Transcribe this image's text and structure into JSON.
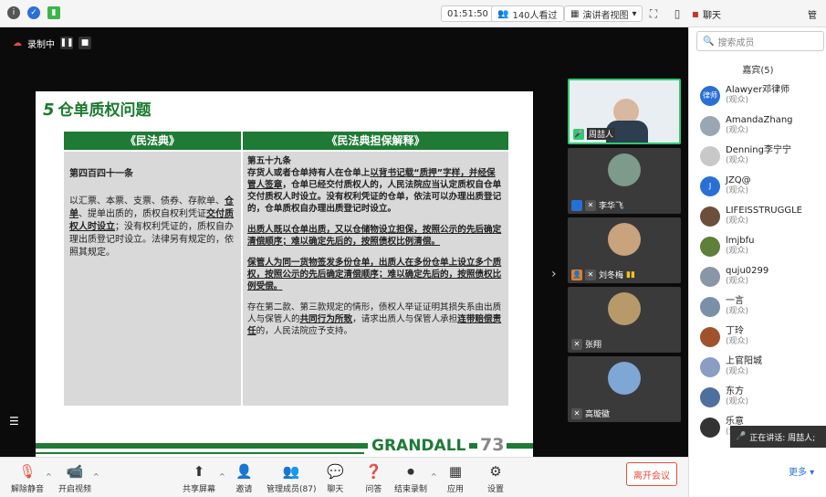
{
  "topbar": {
    "timer": "01:51:50",
    "viewers": "140人看过",
    "view_mode": "演讲者视图",
    "chat_tab": "聊天",
    "tab_right": "管"
  },
  "recording": {
    "label": "录制中"
  },
  "slide": {
    "number": "5",
    "title": "仓单质权问题",
    "col1_head": "《民法典》",
    "col2_head": "《民法典担保解释》",
    "col1_article": "第四百四十一条",
    "col1_text_a": "以汇票、本票、支票、债券、存款单、",
    "col1_text_b": "仓单",
    "col1_text_c": "、提单出质的，质权自权利凭证",
    "col1_text_d": "交付质权人时设立",
    "col1_text_e": "；没有权利凭证的，质权自办理出质登记时设立。法律另有规定的，依照其规定。",
    "col2_article": "第五十九条",
    "col2_p1_a": " 存货人或者仓单持有人在仓单上",
    "col2_p1_b": "以背书记载“质押”字样，并经保管人签章",
    "col2_p1_c": "，仓单已经交付质权人的，人民法院应当认定质权自仓单交付质权人时设立。没有权利凭证的仓单，依法可以办理出质登记的，仓单质权自办理出质登记时设立。",
    "col2_p2": "出质人既以仓单出质，又以仓储物设立担保，按照公示的先后确定清偿顺序；难以确定先后的，按照债权比例清偿。",
    "col2_p3": "保管人为同一货物签发多份仓单，出质人在多份仓单上设立多个质权，按照公示的先后确定清偿顺序；难以确定先后的，按照债权比例受偿。",
    "col2_p4_a": "存在第二款、第三款规定的情形，债权人举证证明其损失系由出质人与保管人的",
    "col2_p4_b": "共同行为所致",
    "col2_p4_c": "，请求出质人与保管人承担",
    "col2_p4_d": "连带赔偿责任",
    "col2_p4_e": "的，人民法院应予支持。",
    "logo": "GRANDALL",
    "page": "73"
  },
  "tiles": [
    {
      "name": "周喆人"
    },
    {
      "name": "李华飞"
    },
    {
      "name": "刘冬梅"
    },
    {
      "name": "张翔"
    },
    {
      "name": "高璇徽"
    }
  ],
  "sidebar": {
    "search_placeholder": "搜索成员",
    "guest_header": "嘉宾(5)",
    "participants": [
      {
        "name": "Alawyer邓律师",
        "role": "(观众)",
        "avatar": "律师",
        "color": "#2a6fd6"
      },
      {
        "name": "AmandaZhang",
        "role": "(观众)",
        "avatar": "",
        "color": "#9aa6b2"
      },
      {
        "name": "Denning李宁宁",
        "role": "(观众)",
        "avatar": "",
        "color": "#c8c8c8"
      },
      {
        "name": "JZQ@",
        "role": "(观众)",
        "avatar": "J",
        "color": "#2a6fd6"
      },
      {
        "name": "LIFEISSTRUGGLE",
        "role": "(观众)",
        "avatar": "",
        "color": "#6b4f3a"
      },
      {
        "name": "lmjbfu",
        "role": "(观众)",
        "avatar": "",
        "color": "#5f7f3a"
      },
      {
        "name": "quju0299",
        "role": "(观众)",
        "avatar": "",
        "color": "#8896a8"
      },
      {
        "name": "一言",
        "role": "(观众)",
        "avatar": "",
        "color": "#7a8fa8"
      },
      {
        "name": "丁玲",
        "role": "(观众)",
        "avatar": "",
        "color": "#a0522d"
      },
      {
        "name": "上官阳城",
        "role": "(观众)",
        "avatar": "",
        "color": "#8b9dc3"
      },
      {
        "name": "东方",
        "role": "(观众)",
        "avatar": "",
        "color": "#4f6f9f"
      },
      {
        "name": "乐意",
        "role": "(观众)",
        "avatar": "",
        "color": "#333"
      }
    ],
    "speaking_label": "正在讲话: 周喆人;",
    "more": "更多"
  },
  "bottombar": {
    "unmute": "解除静音",
    "video": "开启视频",
    "share": "共享屏幕",
    "invite": "邀请",
    "members": "管理成员(87)",
    "chat": "聊天",
    "qa": "问答",
    "end_record": "结束录制",
    "apps": "应用",
    "settings": "设置",
    "leave": "离开会议"
  }
}
